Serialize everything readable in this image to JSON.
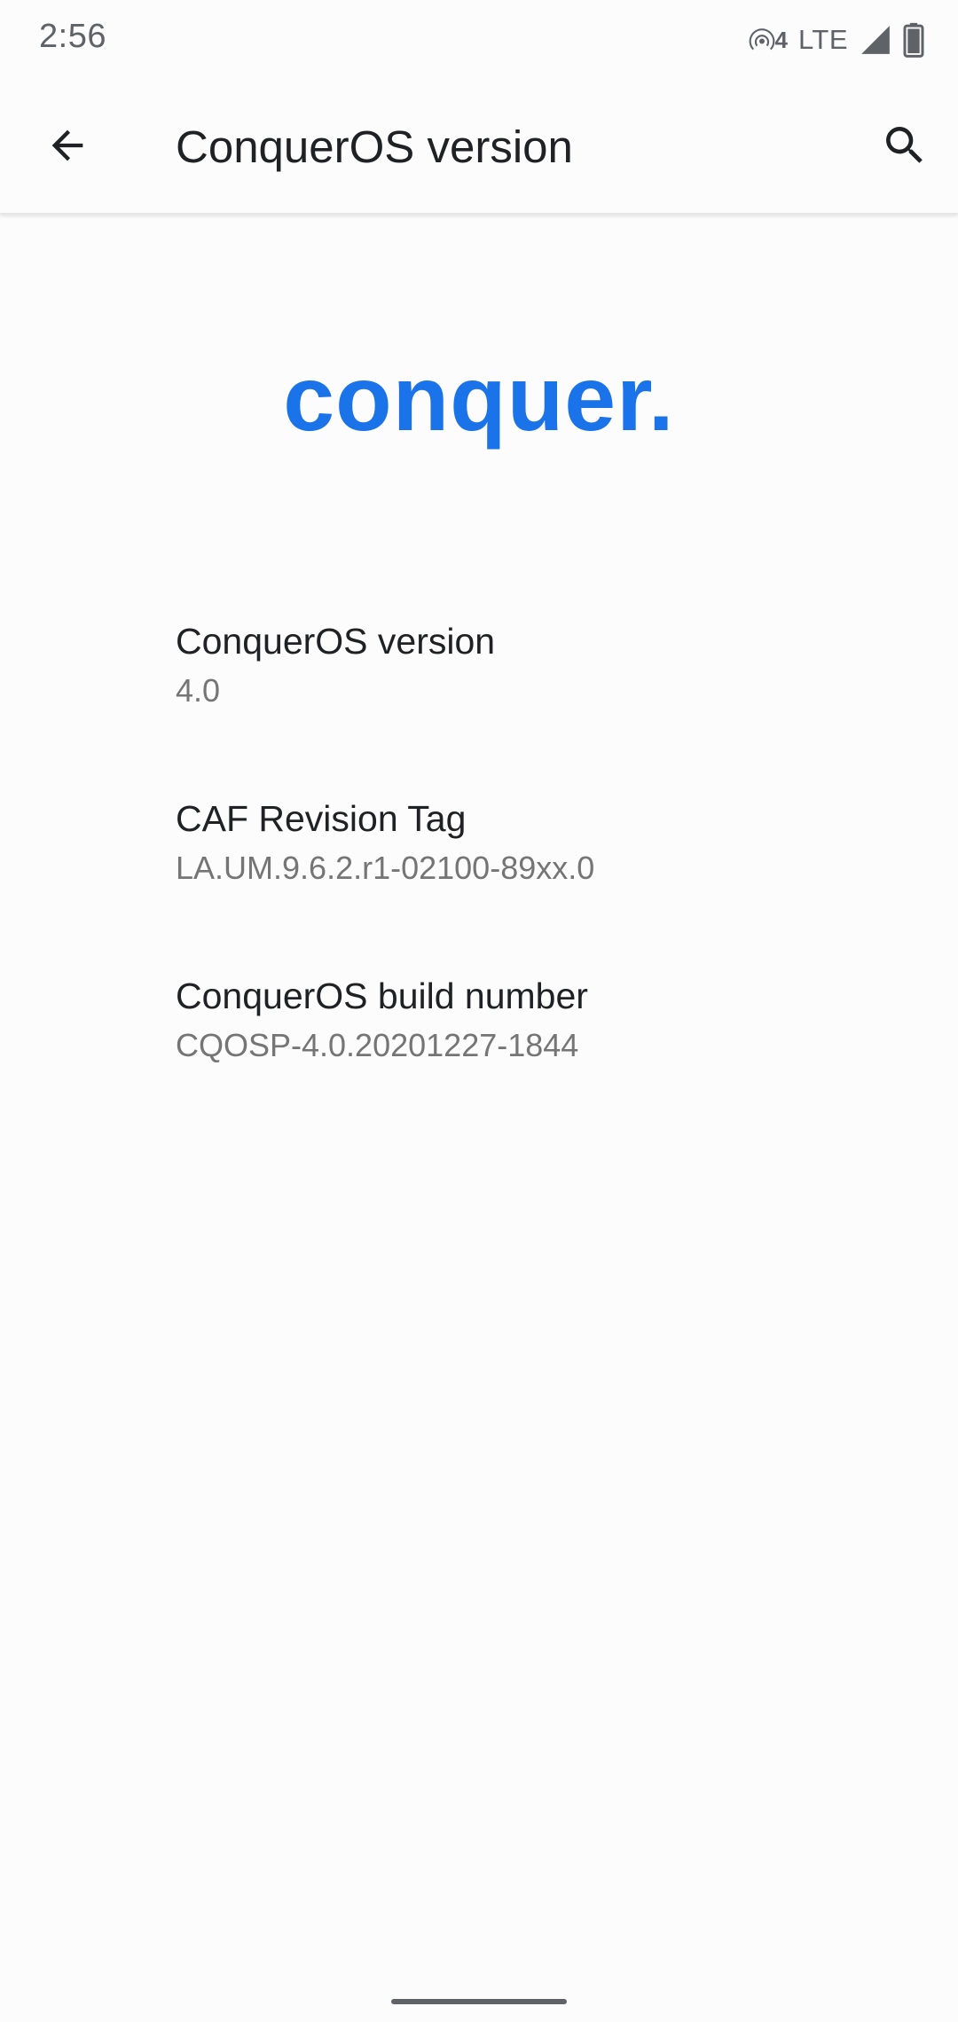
{
  "status_bar": {
    "time": "2:56",
    "hotspot_badge": "4",
    "network": "LTE",
    "icons": [
      "hotspot-icon",
      "signal-icon",
      "battery-icon"
    ]
  },
  "app_bar": {
    "title": "ConquerOS version",
    "back_icon": "arrow-back-icon",
    "search_icon": "search-icon"
  },
  "logo": {
    "text": "conquer.",
    "color": "#1a73e8"
  },
  "preferences": [
    {
      "title": "ConquerOS version",
      "summary": "4.0"
    },
    {
      "title": "CAF Revision Tag",
      "summary": "LA.UM.9.6.2.r1-02100-89xx.0"
    },
    {
      "title": "ConquerOS build number",
      "summary": "CQOSP-4.0.20201227-1844"
    }
  ]
}
